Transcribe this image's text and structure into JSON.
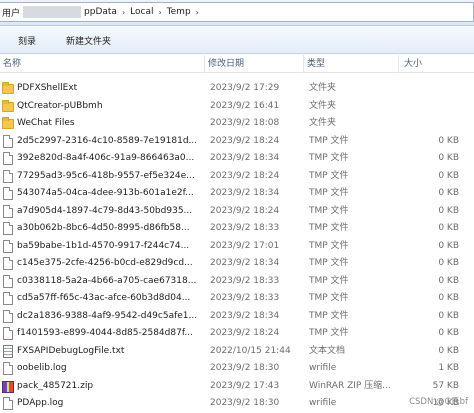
{
  "address": {
    "crumbs": [
      "用户",
      "ppData",
      "Local",
      "Temp"
    ],
    "separator": "›"
  },
  "toolbar": {
    "burn_label": "刻录",
    "new_folder_label": "新建文件夹"
  },
  "columns": {
    "name": "名称",
    "date": "修改日期",
    "type": "类型",
    "size": "大小"
  },
  "files": [
    {
      "icon": "folder-icon",
      "name": "PDFXShellExt",
      "date": "2023/9/2 17:29",
      "type": "文件夹",
      "size": ""
    },
    {
      "icon": "folder-icon",
      "name": "QtCreator-pUBbmh",
      "date": "2023/9/2 16:41",
      "type": "文件夹",
      "size": ""
    },
    {
      "icon": "folder-icon",
      "name": "WeChat Files",
      "date": "2023/9/2 18:08",
      "type": "文件夹",
      "size": ""
    },
    {
      "icon": "file-icon",
      "name": "2d5c2997-2316-4c10-8589-7e19181d...",
      "date": "2023/9/2 18:24",
      "type": "TMP 文件",
      "size": "0 KB"
    },
    {
      "icon": "file-icon",
      "name": "392e820d-8a4f-406c-91a9-866463a0...",
      "date": "2023/9/2 18:34",
      "type": "TMP 文件",
      "size": "0 KB"
    },
    {
      "icon": "file-icon",
      "name": "77295ad3-95c6-418b-9557-ef5e324e...",
      "date": "2023/9/2 18:24",
      "type": "TMP 文件",
      "size": "0 KB"
    },
    {
      "icon": "file-icon",
      "name": "543074a5-04ca-4dee-913b-601a1e2f...",
      "date": "2023/9/2 18:34",
      "type": "TMP 文件",
      "size": "0 KB"
    },
    {
      "icon": "file-icon",
      "name": "a7d905d4-1897-4c79-8d43-50bd935...",
      "date": "2023/9/2 18:24",
      "type": "TMP 文件",
      "size": "0 KB"
    },
    {
      "icon": "file-icon",
      "name": "a30b062b-8bc6-4d50-8995-d86fb58...",
      "date": "2023/9/2 18:33",
      "type": "TMP 文件",
      "size": "0 KB"
    },
    {
      "icon": "file-icon",
      "name": "ba59babe-1b1d-4570-9917-f244c74...",
      "date": "2023/9/2 17:01",
      "type": "TMP 文件",
      "size": "0 KB"
    },
    {
      "icon": "file-icon",
      "name": "c145e375-2cfe-4256-b0cd-e829d9cd...",
      "date": "2023/9/2 18:34",
      "type": "TMP 文件",
      "size": "0 KB"
    },
    {
      "icon": "file-icon",
      "name": "c0338118-5a2a-4b66-a705-cae67318...",
      "date": "2023/9/2 18:33",
      "type": "TMP 文件",
      "size": "0 KB"
    },
    {
      "icon": "file-icon",
      "name": "cd5a57ff-f65c-43ac-afce-60b3d8d04...",
      "date": "2023/9/2 18:33",
      "type": "TMP 文件",
      "size": "0 KB"
    },
    {
      "icon": "file-icon",
      "name": "dc2a1836-9388-4af9-9542-d49c5afe1...",
      "date": "2023/9/2 18:34",
      "type": "TMP 文件",
      "size": "0 KB"
    },
    {
      "icon": "file-icon",
      "name": "f1401593-e899-4044-8d85-2584d87f...",
      "date": "2023/9/2 18:24",
      "type": "TMP 文件",
      "size": "0 KB"
    },
    {
      "icon": "text-file-icon",
      "name": "FXSAPIDebugLogFile.txt",
      "date": "2022/10/15 21:44",
      "type": "文本文档",
      "size": "0 KB"
    },
    {
      "icon": "file-icon",
      "name": "oobelib.log",
      "date": "2023/9/2 18:30",
      "type": "wrifile",
      "size": "1 KB"
    },
    {
      "icon": "zip-icon",
      "name": "pack_485721.zip",
      "date": "2023/9/2 17:43",
      "type": "WinRAR ZIP 压缩...",
      "size": "57 KB"
    },
    {
      "icon": "file-icon",
      "name": "PDApp.log",
      "date": "2023/9/2 18:30",
      "type": "wrifile",
      "size": "10 KB"
    }
  ],
  "watermark": "CSDN @G氏bf"
}
